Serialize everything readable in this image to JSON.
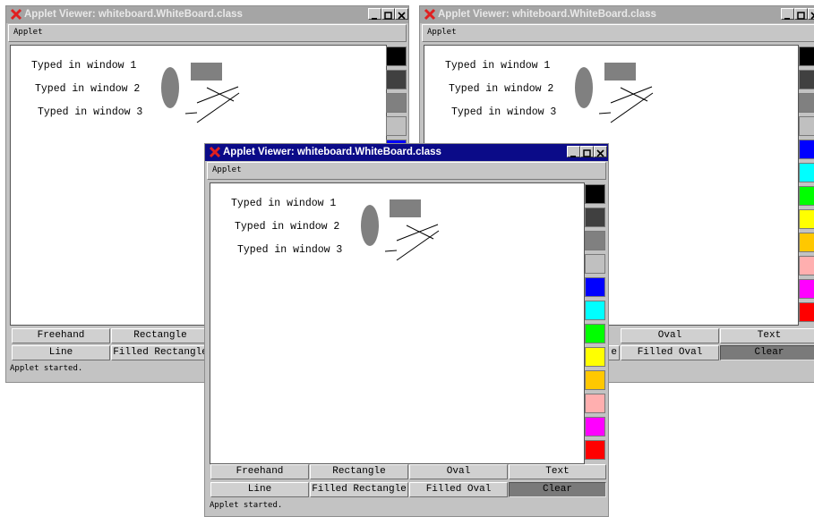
{
  "window_title": "Applet Viewer: whiteboard.WhiteBoard.class",
  "menu_label": "Applet",
  "status_text": "Applet started.",
  "canvas_texts": [
    "Typed in window 1",
    "Typed in window 2",
    "Typed in window 3"
  ],
  "tools": {
    "freehand": "Freehand",
    "rectangle": "Rectangle",
    "oval": "Oval",
    "text": "Text",
    "line": "Line",
    "filled_rectangle": "Filled Rectangle",
    "filled_oval": "Filled Oval",
    "clear": "Clear"
  },
  "right_window_partial_label": "e",
  "palette_colors": [
    "#000000",
    "#404040",
    "#808080",
    "#c0c0c0",
    "#0000ff",
    "#00ffff",
    "#00ff00",
    "#ffff00",
    "#ffc800",
    "#ffafaf",
    "#ff00ff",
    "#ff0000"
  ],
  "shape_color": "#808080",
  "active_title_color": "#0b0b88",
  "inactive_title_color": "#a5a5a5"
}
